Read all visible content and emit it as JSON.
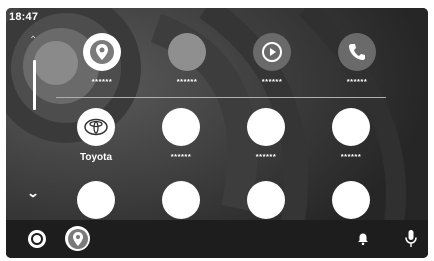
{
  "status": {
    "time": "18:47"
  },
  "apps": [
    {
      "label": "******",
      "icon": "maps-icon",
      "style": "white"
    },
    {
      "label": "******",
      "icon": "blank-icon",
      "style": "gray"
    },
    {
      "label": "******",
      "icon": "play-icon",
      "style": "dark"
    },
    {
      "label": "******",
      "icon": "phone-icon",
      "style": "dark"
    },
    {
      "label": "Toyota",
      "icon": "toyota-logo-icon",
      "style": "white"
    },
    {
      "label": "******",
      "icon": "blank-icon",
      "style": "white"
    },
    {
      "label": "******",
      "icon": "blank-icon",
      "style": "white"
    },
    {
      "label": "******",
      "icon": "blank-icon",
      "style": "white"
    },
    {
      "label": "",
      "icon": "blank-icon",
      "style": "white"
    },
    {
      "label": "",
      "icon": "blank-icon",
      "style": "white"
    },
    {
      "label": "",
      "icon": "blank-icon",
      "style": "white"
    },
    {
      "label": "",
      "icon": "blank-icon",
      "style": "white"
    }
  ],
  "dock": {
    "home": "home-icon",
    "maps": "maps-icon",
    "notifications": "bell-icon",
    "voice": "microphone-icon"
  },
  "colors": {
    "background": "#2b2b2b",
    "dock": "#1d1d1d",
    "icon": "#ffffff"
  }
}
